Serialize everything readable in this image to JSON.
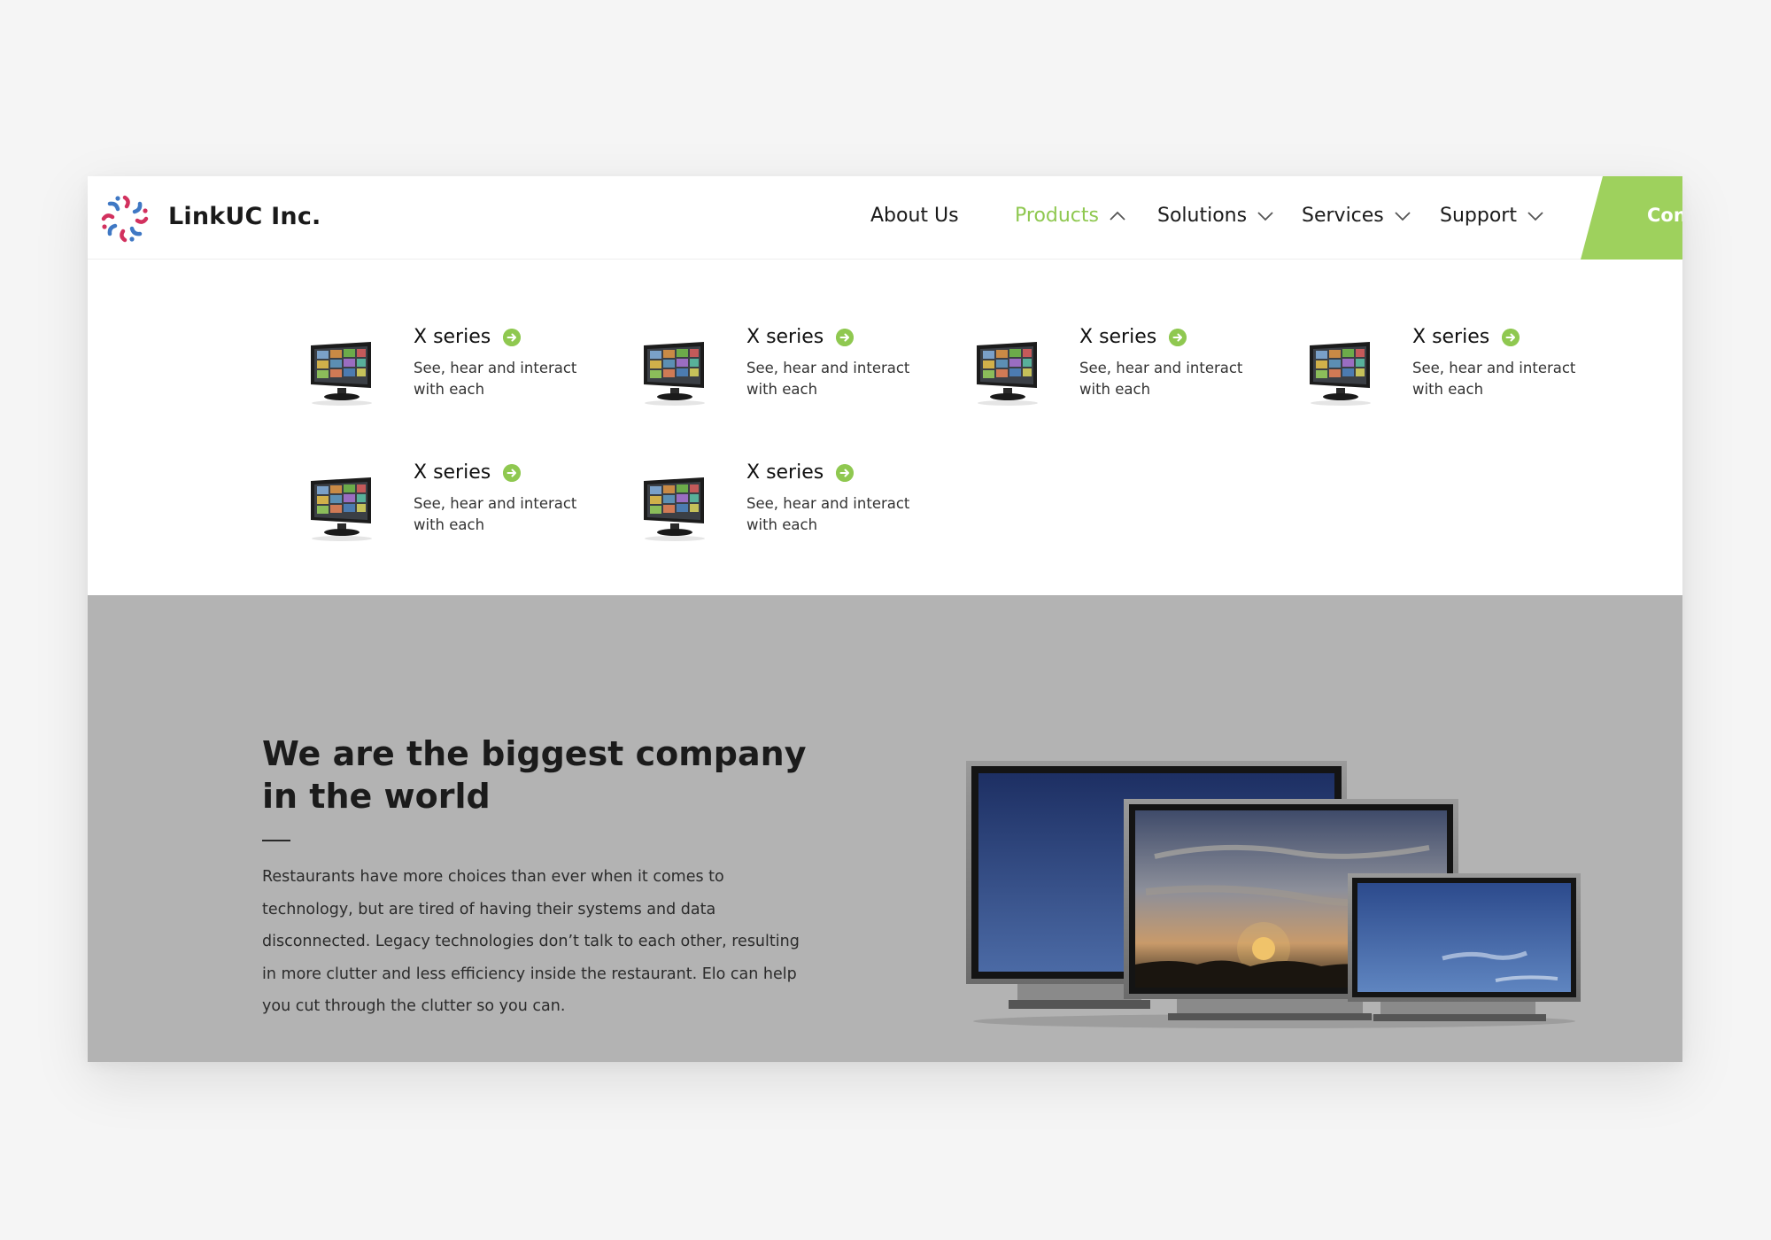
{
  "brand": {
    "name": "LinkUC Inc.",
    "colors": {
      "accent": "#8fc850",
      "cta": "#9ed15d",
      "logo_red": "#d2315e",
      "logo_blue": "#3f78c4"
    }
  },
  "nav": {
    "items": [
      {
        "label": "About Us",
        "dropdown": false,
        "active": false
      },
      {
        "label": "Products",
        "dropdown": true,
        "active": true,
        "icon": "chevron-up-icon"
      },
      {
        "label": "Solutions",
        "dropdown": true,
        "active": false,
        "icon": "chevron-down-icon"
      },
      {
        "label": "Services",
        "dropdown": true,
        "active": false,
        "icon": "chevron-down-icon"
      },
      {
        "label": "Support",
        "dropdown": true,
        "active": false,
        "icon": "chevron-down-icon"
      }
    ],
    "cta_label": "Con"
  },
  "products_menu": {
    "items": [
      {
        "title": "X series",
        "desc": "See, hear and interact with each",
        "icon": "arrow-right-circle-icon"
      },
      {
        "title": "X series",
        "desc": "See, hear and interact with each",
        "icon": "arrow-right-circle-icon"
      },
      {
        "title": "X series",
        "desc": "See, hear and interact with each",
        "icon": "arrow-right-circle-icon"
      },
      {
        "title": "X series",
        "desc": "See, hear and interact with each",
        "icon": "arrow-right-circle-icon"
      },
      {
        "title": "X series",
        "desc": "See, hear and interact with each",
        "icon": "arrow-right-circle-icon"
      },
      {
        "title": "X series",
        "desc": "See, hear and interact with each",
        "icon": "arrow-right-circle-icon"
      }
    ]
  },
  "hero": {
    "title": "We are the biggest company in the world",
    "body": "Restaurants have more choices than ever when it comes to technology, but are tired of having their systems and data disconnected. Legacy technologies don’t talk to each other, resulting in more clutter and less efficiency inside the restaurant. Elo can help you cut through the clutter so you can."
  }
}
